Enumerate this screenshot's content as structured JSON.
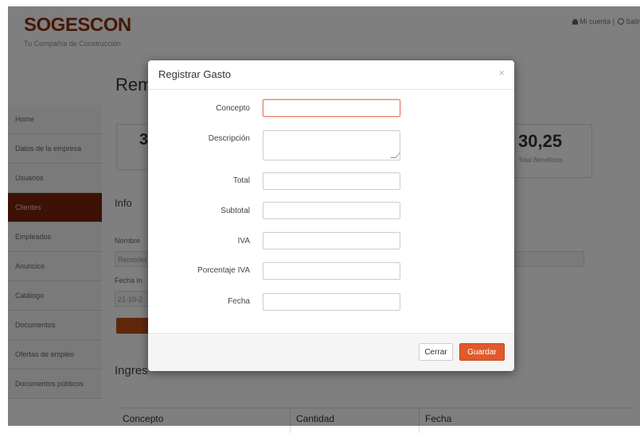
{
  "app": {
    "brand": "SOGESCON",
    "tagline": "Tu Compañía de Construcción",
    "user_link": "Mi cuenta",
    "logout_link": "Salir"
  },
  "page": {
    "title": "Rem",
    "stat_left": "3",
    "stat_right_value": "30,25",
    "stat_right_label": "Total Beneficios",
    "info_heading": "Info",
    "nombre_label": "Nombre",
    "nombre_value": "Remodel",
    "fecha_label": "Fecha In",
    "fecha_value": "21-10-2",
    "ingresos_heading": "Ingres",
    "table_headers": [
      "Concepto",
      "Cantidad",
      "Fecha"
    ]
  },
  "sidebar": {
    "items": [
      {
        "label": "Home"
      },
      {
        "label": "Datos de la empresa"
      },
      {
        "label": "Usuarios"
      },
      {
        "label": "Clientes"
      },
      {
        "label": "Empleados"
      },
      {
        "label": "Anuncios"
      },
      {
        "label": "Catálogo"
      },
      {
        "label": "Documentos"
      },
      {
        "label": "Ofertas de empleo"
      },
      {
        "label": "Documentos públicos"
      }
    ],
    "active_index": 3
  },
  "modal": {
    "title": "Registrar Gasto",
    "close_symbol": "×",
    "fields": {
      "concepto": {
        "label": "Concepto",
        "value": ""
      },
      "descripcion": {
        "label": "Descripción",
        "value": ""
      },
      "total": {
        "label": "Total",
        "value": ""
      },
      "subtotal": {
        "label": "Subtotal",
        "value": ""
      },
      "iva": {
        "label": "IVA",
        "value": ""
      },
      "porcentaje_iva": {
        "label": "Porcentaje IVA",
        "value": ""
      },
      "fecha": {
        "label": "Fecha",
        "value": ""
      }
    },
    "buttons": {
      "cancel": "Cerrar",
      "save": "Guardar"
    }
  },
  "colors": {
    "brand": "#8e2f0e",
    "active_nav": "#7a2408",
    "primary_button": "#e05a2b"
  }
}
